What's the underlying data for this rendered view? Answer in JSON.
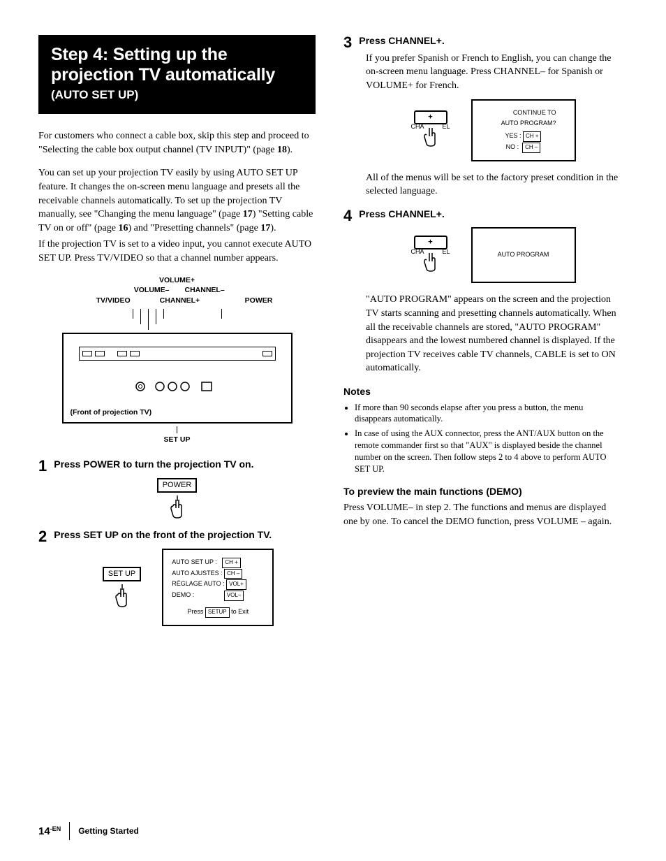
{
  "heading": {
    "main": "Step 4: Setting up the projection TV automatically",
    "sub": "(AUTO SET UP)"
  },
  "left": {
    "intro1a": "For customers who connect a cable box, skip this step and proceed to \"Selecting the cable box output channel (TV INPUT)\" (page ",
    "intro1b": "18",
    "intro1c": ").",
    "intro2a": "You can set up your projection TV easily by using AUTO SET UP feature. It changes the on-screen menu language and presets all the receivable channels automatically. To set up the projection TV manually, see \"Changing the menu language\" (page ",
    "intro2b": "17",
    "intro2c": ") \"Setting cable TV on or off\" (page ",
    "intro2d": "16",
    "intro2e": ") and \"Presetting channels\" (page ",
    "intro2f": "17",
    "intro2g": ").",
    "intro3": "If the projection TV is set to a video input, you cannot execute AUTO SET UP. Press TV/VIDEO so that a channel number appears.",
    "panel_labels": {
      "volplus": "VOLUME+",
      "volminus": "VOLUME–",
      "chminus": "CHANNEL–",
      "tvvideo": "TV/VIDEO",
      "chplus": "CHANNEL+",
      "power": "POWER",
      "front_caption": "(Front of projection TV)",
      "setup": "SET UP"
    },
    "step1_num": "1",
    "step1_title": "Press POWER to turn the projection TV on.",
    "step1_btn": "POWER",
    "step2_num": "2",
    "step2_title": "Press SET UP on the front of the projection TV.",
    "step2_btn": "SET UP",
    "step2_screen": {
      "l1a": "AUTO SET UP :",
      "l1b": "CH +",
      "l2a": "AUTO AJUSTES :",
      "l2b": "CH –",
      "l3a": "RÉGLAGE AUTO :",
      "l3b": "VOL+",
      "l4a": "DEMO :",
      "l4b": "VOL−",
      "l5a": "Press",
      "l5b": "SETUP",
      "l5c": "to Exit"
    }
  },
  "right": {
    "step3_num": "3",
    "step3_title": "Press CHANNEL+.",
    "step3_body": "If you prefer Spanish or French to English, you can change the on-screen menu language. Press CHANNEL– for Spanish or VOLUME+ for French.",
    "step3_btn_ch": "CHANNEL",
    "step3_screen": {
      "l1": "CONTINUE TO",
      "l2": "AUTO PROGRAM?",
      "yes_a": "YES :",
      "yes_b": "CH +",
      "no_a": "NO :",
      "no_b": "CH –"
    },
    "step3_after": "All of the menus will be set to the factory preset condition in the selected language.",
    "step4_num": "4",
    "step4_title": "Press CHANNEL+.",
    "step4_screen": "AUTO  PROGRAM",
    "step4_body": "\"AUTO PROGRAM\" appears on the screen and the projection TV starts scanning and presetting channels automatically. When all the receivable channels are stored, \"AUTO PROGRAM\" disappears and the lowest numbered channel is displayed. If the projection TV receives cable TV channels, CABLE is set to ON automatically.",
    "notes_head": "Notes",
    "note1": "If more than 90 seconds elapse after you press a button, the menu disappears automatically.",
    "note2": "In case of using the AUX connector, press the ANT/AUX button on the remote commander first so that \"AUX\" is displayed beside the channel number on the screen. Then follow steps 2 to 4 above to perform AUTO SET UP.",
    "demo_head": "To preview the main functions (DEMO)",
    "demo_body": "Press VOLUME– in step 2. The functions and menus are displayed one by one. To cancel the DEMO function, press VOLUME – again."
  },
  "footer": {
    "page_num": "14",
    "page_sup": "-EN",
    "section": "Getting Started"
  },
  "icons": {
    "ch_left": "CHA",
    "ch_right": "EL"
  }
}
